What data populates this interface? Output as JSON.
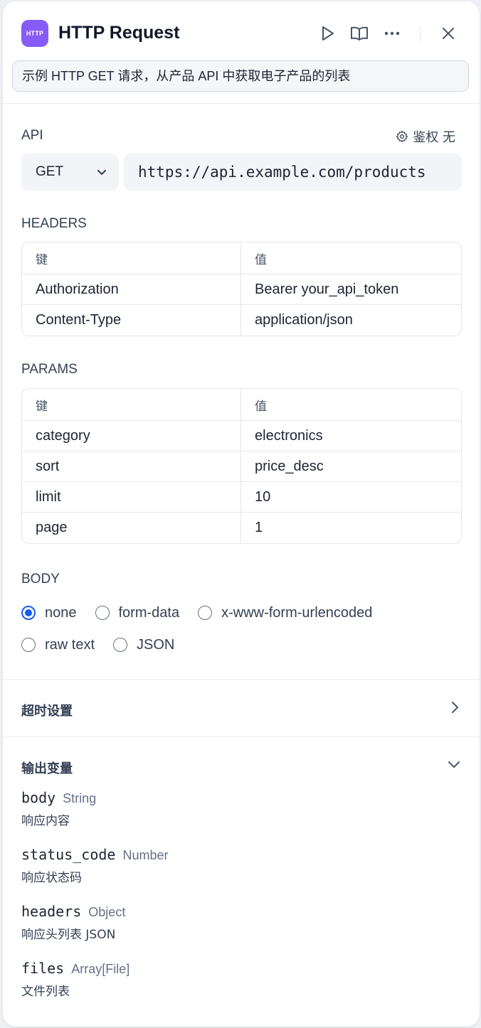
{
  "header": {
    "icon_text": "HTTP",
    "title": "HTTP Request",
    "description": "示例 HTTP GET 请求，从产品 API 中获取电子产品的列表"
  },
  "api": {
    "label": "API",
    "auth_label": "鉴权 无",
    "method": "GET",
    "url": "https://api.example.com/products"
  },
  "headers": {
    "label": "HEADERS",
    "col_key": "键",
    "col_value": "值",
    "rows": [
      {
        "key": "Authorization",
        "value": "Bearer your_api_token"
      },
      {
        "key": "Content-Type",
        "value": "application/json"
      }
    ]
  },
  "params": {
    "label": "PARAMS",
    "col_key": "键",
    "col_value": "值",
    "rows": [
      {
        "key": "category",
        "value": "electronics"
      },
      {
        "key": "sort",
        "value": "price_desc"
      },
      {
        "key": "limit",
        "value": "10"
      },
      {
        "key": "page",
        "value": "1"
      }
    ]
  },
  "body": {
    "label": "BODY",
    "options": [
      "none",
      "form-data",
      "x-www-form-urlencoded",
      "raw text",
      "JSON"
    ],
    "selected": "none"
  },
  "timeout": {
    "title": "超时设置"
  },
  "output": {
    "title": "输出变量",
    "vars": [
      {
        "name": "body",
        "type": "String",
        "desc": "响应内容"
      },
      {
        "name": "status_code",
        "type": "Number",
        "desc": "响应状态码"
      },
      {
        "name": "headers",
        "type": "Object",
        "desc": "响应头列表 JSON"
      },
      {
        "name": "files",
        "type": "Array[File]",
        "desc": "文件列表"
      }
    ]
  },
  "colors": {
    "accent": "#155eef",
    "node_icon": "#875bf7"
  }
}
